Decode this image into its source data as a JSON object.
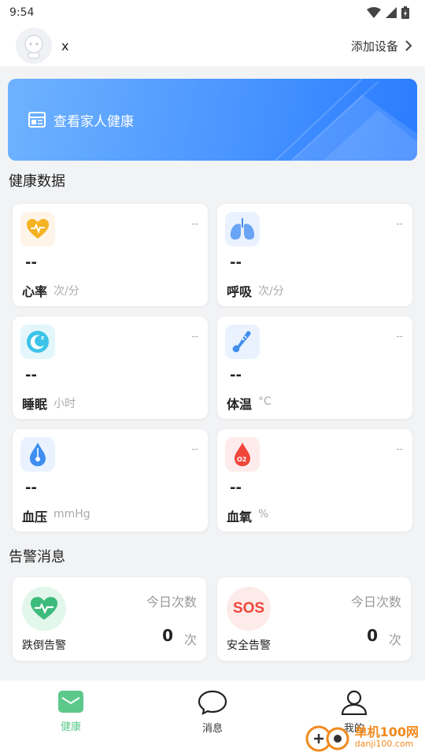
{
  "status_bar": {
    "time": "9:54"
  },
  "header": {
    "user_name": "x",
    "add_device_label": "添加设备"
  },
  "banner": {
    "text": "查看家人健康"
  },
  "health_section": {
    "title": "健康数据",
    "cards": [
      {
        "label": "心率",
        "unit": "次/分",
        "value": "--",
        "corner": "--",
        "icon": "heart-rate-icon"
      },
      {
        "label": "呼吸",
        "unit": "次/分",
        "value": "--",
        "corner": "--",
        "icon": "lungs-icon"
      },
      {
        "label": "睡眠",
        "unit": "小时",
        "value": "--",
        "corner": "--",
        "icon": "sleep-moon-icon"
      },
      {
        "label": "体温",
        "unit": "°C",
        "value": "--",
        "corner": "--",
        "icon": "thermometer-icon"
      },
      {
        "label": "血压",
        "unit": "mmHg",
        "value": "--",
        "corner": "--",
        "icon": "blood-pressure-drop-icon"
      },
      {
        "label": "血氧",
        "unit": "%",
        "value": "--",
        "corner": "--",
        "icon": "blood-oxygen-drop-icon"
      }
    ]
  },
  "alert_section": {
    "title": "告警消息",
    "cards": [
      {
        "label": "跌倒告警",
        "today_label": "今日次数",
        "count": "0",
        "times_unit": "次",
        "icon": "fall-heart-icon"
      },
      {
        "label": "安全告警",
        "today_label": "今日次数",
        "count": "0",
        "times_unit": "次",
        "icon": "sos-icon",
        "icon_text": "SOS"
      }
    ]
  },
  "tab_bar": {
    "tabs": [
      {
        "label": "健康",
        "icon": "health-mail-icon",
        "active": true
      },
      {
        "label": "消息",
        "icon": "chat-bubble-icon",
        "active": false
      },
      {
        "label": "我的",
        "icon": "profile-person-icon",
        "active": false
      }
    ]
  },
  "watermark": {
    "name": "单机100网",
    "url": "danji100.com"
  },
  "colors": {
    "accent_green": "#5cc98a",
    "banner_blue": "#2a7cff",
    "sos_red": "#f0463c"
  }
}
